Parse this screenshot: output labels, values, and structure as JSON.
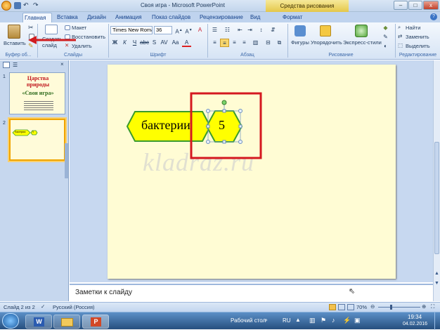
{
  "titlebar": {
    "title": "Своя игра - Microsoft PowerPoint",
    "contextual_tab": "Средства рисования",
    "minimize": "–",
    "maximize": "□",
    "close": "x"
  },
  "tabs": [
    "Главная",
    "Вставка",
    "Дизайн",
    "Анимация",
    "Показ слайдов",
    "Рецензирование",
    "Вид",
    "Формат"
  ],
  "ribbon": {
    "paste": "Вставить",
    "new_slide": "Создать слайд",
    "layout": "Макет",
    "reset": "Восстановить",
    "delete": "Удалить",
    "font_name": "Times New Roma",
    "font_size": "36",
    "shapes": "Фигуры",
    "arrange": "Упорядочить",
    "quick_styles": "Экспресс-стили",
    "find": "Найти",
    "replace": "Заменить",
    "select": "Выделить",
    "groups": {
      "clipboard": "Буфер об...",
      "slides": "Слайды",
      "font": "Шрифт",
      "paragraph": "Абзац",
      "drawing": "Рисование",
      "editing": "Редактирование"
    }
  },
  "thumbnails": {
    "slide1_title": "Царства природы",
    "slide1_subtitle": "«Своя игра»",
    "slide2_label": "бактерии",
    "slide2_value": "5"
  },
  "slide": {
    "category_label": "бактерии",
    "value_label": "5",
    "watermark": "kladraz.ru"
  },
  "notes_placeholder": "Заметки к слайду",
  "status": {
    "slide_info": "Слайд 2 из 2",
    "language": "Русский (Россия)",
    "zoom": "70%"
  },
  "taskbar": {
    "desktop": "Рабочий стол",
    "lang": "RU",
    "time": "19:34",
    "date": "04.02.2016"
  },
  "colors": {
    "slide_bg": "#fffcd4",
    "shape_fill": "#ffff00",
    "shape_stroke": "#3a9b2c",
    "highlight_box": "#d4181f",
    "arrow": "#d01d20"
  }
}
